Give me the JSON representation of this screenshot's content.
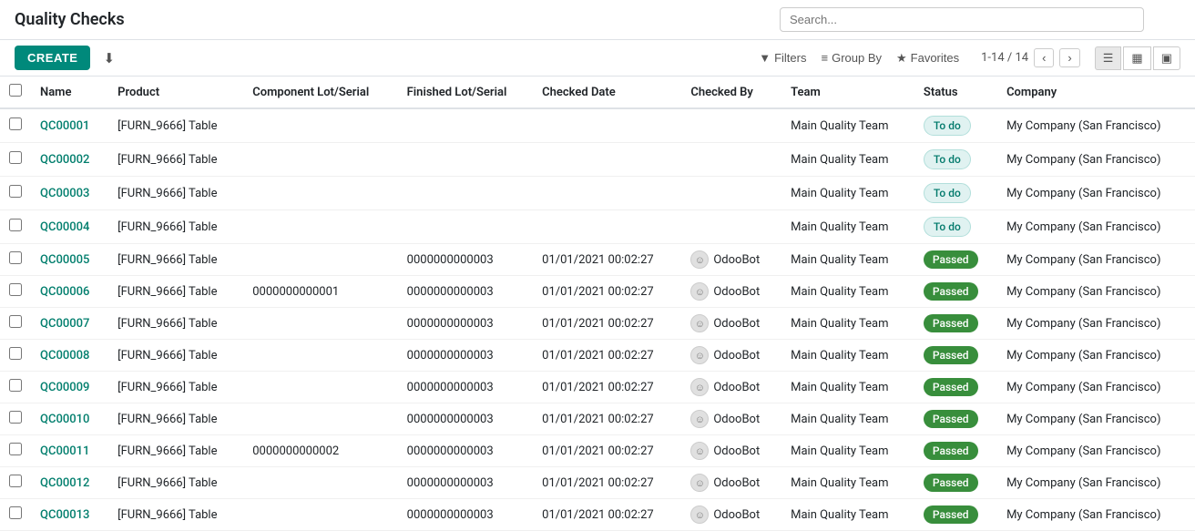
{
  "page": {
    "title": "Quality Checks",
    "search_placeholder": "Search..."
  },
  "toolbar": {
    "create_label": "CREATE",
    "download_icon": "⬇",
    "filters_label": "Filters",
    "group_by_label": "Group By",
    "favorites_label": "Favorites",
    "pagination": "1-14 / 14"
  },
  "columns": [
    "Name",
    "Product",
    "Component Lot/Serial",
    "Finished Lot/Serial",
    "Checked Date",
    "Checked By",
    "Team",
    "Status",
    "Company"
  ],
  "rows": [
    {
      "name": "QC00001",
      "product": "[FURN_9666] Table",
      "comp_lot": "",
      "fin_lot": "",
      "checked_date": "",
      "checked_by": "",
      "team": "Main Quality Team",
      "status": "To do",
      "company": "My Company (San Francisco)"
    },
    {
      "name": "QC00002",
      "product": "[FURN_9666] Table",
      "comp_lot": "",
      "fin_lot": "",
      "checked_date": "",
      "checked_by": "",
      "team": "Main Quality Team",
      "status": "To do",
      "company": "My Company (San Francisco)"
    },
    {
      "name": "QC00003",
      "product": "[FURN_9666] Table",
      "comp_lot": "",
      "fin_lot": "",
      "checked_date": "",
      "checked_by": "",
      "team": "Main Quality Team",
      "status": "To do",
      "company": "My Company (San Francisco)"
    },
    {
      "name": "QC00004",
      "product": "[FURN_9666] Table",
      "comp_lot": "",
      "fin_lot": "",
      "checked_date": "",
      "checked_by": "",
      "team": "Main Quality Team",
      "status": "To do",
      "company": "My Company (San Francisco)"
    },
    {
      "name": "QC00005",
      "product": "[FURN_9666] Table",
      "comp_lot": "",
      "fin_lot": "0000000000003",
      "checked_date": "01/01/2021 00:02:27",
      "checked_by": "OdooBot",
      "team": "Main Quality Team",
      "status": "Passed",
      "company": "My Company (San Francisco)"
    },
    {
      "name": "QC00006",
      "product": "[FURN_9666] Table",
      "comp_lot": "0000000000001",
      "fin_lot": "0000000000003",
      "checked_date": "01/01/2021 00:02:27",
      "checked_by": "OdooBot",
      "team": "Main Quality Team",
      "status": "Passed",
      "company": "My Company (San Francisco)"
    },
    {
      "name": "QC00007",
      "product": "[FURN_9666] Table",
      "comp_lot": "",
      "fin_lot": "0000000000003",
      "checked_date": "01/01/2021 00:02:27",
      "checked_by": "OdooBot",
      "team": "Main Quality Team",
      "status": "Passed",
      "company": "My Company (San Francisco)"
    },
    {
      "name": "QC00008",
      "product": "[FURN_9666] Table",
      "comp_lot": "",
      "fin_lot": "0000000000003",
      "checked_date": "01/01/2021 00:02:27",
      "checked_by": "OdooBot",
      "team": "Main Quality Team",
      "status": "Passed",
      "company": "My Company (San Francisco)"
    },
    {
      "name": "QC00009",
      "product": "[FURN_9666] Table",
      "comp_lot": "",
      "fin_lot": "0000000000003",
      "checked_date": "01/01/2021 00:02:27",
      "checked_by": "OdooBot",
      "team": "Main Quality Team",
      "status": "Passed",
      "company": "My Company (San Francisco)"
    },
    {
      "name": "QC00010",
      "product": "[FURN_9666] Table",
      "comp_lot": "",
      "fin_lot": "0000000000003",
      "checked_date": "01/01/2021 00:02:27",
      "checked_by": "OdooBot",
      "team": "Main Quality Team",
      "status": "Passed",
      "company": "My Company (San Francisco)"
    },
    {
      "name": "QC00011",
      "product": "[FURN_9666] Table",
      "comp_lot": "0000000000002",
      "fin_lot": "0000000000003",
      "checked_date": "01/01/2021 00:02:27",
      "checked_by": "OdooBot",
      "team": "Main Quality Team",
      "status": "Passed",
      "company": "My Company (San Francisco)"
    },
    {
      "name": "QC00012",
      "product": "[FURN_9666] Table",
      "comp_lot": "",
      "fin_lot": "0000000000003",
      "checked_date": "01/01/2021 00:02:27",
      "checked_by": "OdooBot",
      "team": "Main Quality Team",
      "status": "Passed",
      "company": "My Company (San Francisco)"
    },
    {
      "name": "QC00013",
      "product": "[FURN_9666] Table",
      "comp_lot": "",
      "fin_lot": "0000000000003",
      "checked_date": "01/01/2021 00:02:27",
      "checked_by": "OdooBot",
      "team": "Main Quality Team",
      "status": "Passed",
      "company": "My Company (San Francisco)"
    }
  ]
}
